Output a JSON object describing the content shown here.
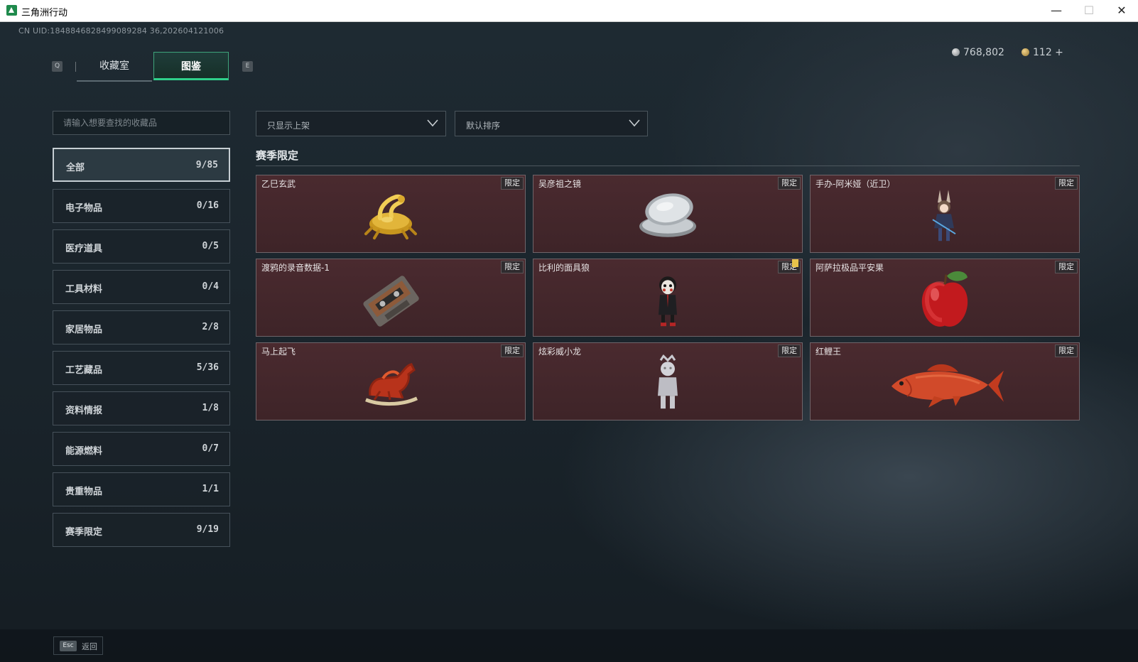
{
  "window": {
    "title": "三角洲行动",
    "min_symbol": "—",
    "max_symbol": "☐",
    "close_symbol": "✕"
  },
  "header": {
    "uid": "CN UID:1848846828499089284 36,202604121006",
    "tab_key_left": "Q",
    "tab_key_right": "E",
    "tabs": [
      {
        "label": "收藏室"
      },
      {
        "label": "图鉴"
      }
    ],
    "currency": [
      {
        "icon": "silver-coin-icon",
        "value": "768,802"
      },
      {
        "icon": "gold-coin-icon",
        "value": "112 +"
      }
    ]
  },
  "search": {
    "placeholder": "请输入想要查找的收藏品"
  },
  "categories": [
    {
      "label": "全部",
      "count": "9/85"
    },
    {
      "label": "电子物品",
      "count": "0/16"
    },
    {
      "label": "医疗道具",
      "count": "0/5"
    },
    {
      "label": "工具材料",
      "count": "0/4"
    },
    {
      "label": "家居物品",
      "count": "2/8"
    },
    {
      "label": "工艺藏品",
      "count": "5/36"
    },
    {
      "label": "资料情报",
      "count": "1/8"
    },
    {
      "label": "能源燃料",
      "count": "0/7"
    },
    {
      "label": "贵重物品",
      "count": "1/1"
    },
    {
      "label": "赛季限定",
      "count": "9/19"
    }
  ],
  "filters": {
    "shelf": "只显示上架",
    "sort": "默认排序"
  },
  "section": {
    "title": "赛季限定"
  },
  "items": [
    {
      "name": "乙巳玄武",
      "tag": "限定",
      "icon": "golden-serpent-tortoise"
    },
    {
      "name": "吴彦祖之镜",
      "tag": "限定",
      "icon": "compact-mirror"
    },
    {
      "name": "手办-阿米娅（近卫）",
      "tag": "限定",
      "icon": "amiya-figure"
    },
    {
      "name": "渡鸦的录音数据-1",
      "tag": "限定",
      "icon": "cassette-tape"
    },
    {
      "name": "比利的面具狼",
      "tag": "限定",
      "icon": "billy-puppet"
    },
    {
      "name": "阿萨拉极品平安果",
      "tag": "限定",
      "icon": "red-apple"
    },
    {
      "name": "马上起飞",
      "tag": "限定",
      "icon": "red-horse-statue"
    },
    {
      "name": "炫彩威小龙",
      "tag": "限定",
      "icon": "silver-figure"
    },
    {
      "name": "红鲤王",
      "tag": "限定",
      "icon": "red-carp"
    }
  ],
  "footer": {
    "esc_key": "Esc",
    "back_label": "返回"
  },
  "colors": {
    "accent": "#2fd08a",
    "card_bg": "#4a2a2f",
    "bg": "#1c252c"
  }
}
